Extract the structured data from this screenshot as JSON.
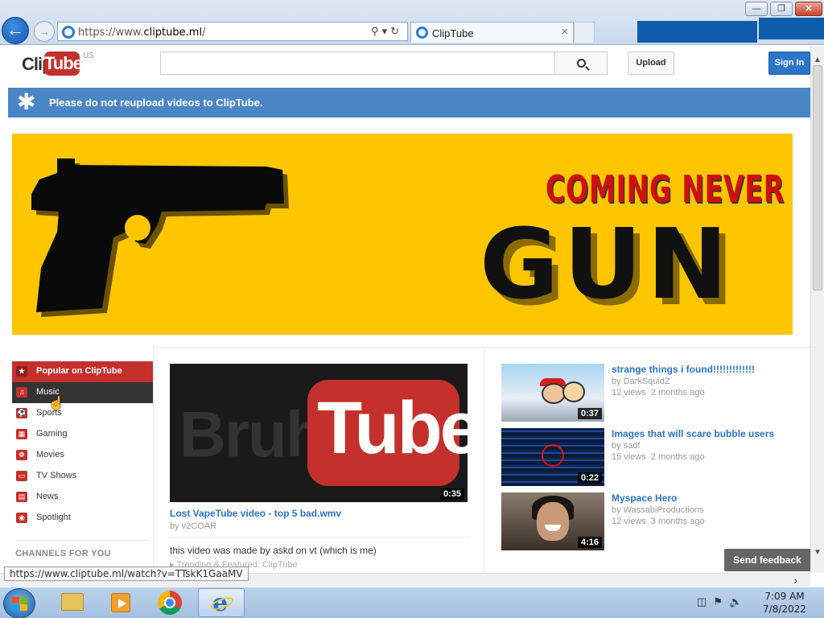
{
  "browser": {
    "url_prefix": "https://www.",
    "url_domain": "cliptube.ml",
    "url_suffix": "/",
    "tab_title": "ClipTube",
    "tab_close": "×",
    "status_url": "https://www.cliptube.ml/watch?v=TTskK1GaaMV"
  },
  "header": {
    "logo_clip": "Clip",
    "logo_tube": "Tube",
    "region": "US",
    "search_placeholder": "",
    "upload_label": "Upload",
    "signin_label": "Sign In"
  },
  "notice": {
    "text": "Please do not reupload videos to ClipTube."
  },
  "banner": {
    "line1": "COMING NEVER",
    "line2": "GUN"
  },
  "guide": {
    "items": [
      {
        "label": "Popular on ClipTube",
        "icon": "star-icon",
        "state": "active"
      },
      {
        "label": "Music",
        "icon": "headphones-icon",
        "state": "hover"
      },
      {
        "label": "Sports",
        "icon": "ball-icon",
        "state": ""
      },
      {
        "label": "Gaming",
        "icon": "gamepad-icon",
        "state": ""
      },
      {
        "label": "Movies",
        "icon": "film-reel-icon",
        "state": ""
      },
      {
        "label": "TV Shows",
        "icon": "tv-icon",
        "state": ""
      },
      {
        "label": "News",
        "icon": "newspaper-icon",
        "state": ""
      },
      {
        "label": "Spotlight",
        "icon": "spotlight-icon",
        "state": ""
      }
    ],
    "channels_heading": "CHANNELS FOR YOU"
  },
  "featured": {
    "thumb_left": "Bruh",
    "thumb_right": "Tube",
    "duration": "0:35",
    "title": "Lost VapeTube video - top 5 bad.wmv",
    "by": "by v2COAR",
    "description": "this video was made by askd on vt (which is me)",
    "category": "Trending & Featured: ClipTube"
  },
  "side_videos": [
    {
      "title": "strange things i found!!!!!!!!!!!!!",
      "by": "by DarkSquidZ",
      "views": "12 views",
      "age": "2 months ago",
      "duration": "0:37"
    },
    {
      "title": "Images that will scare bubble users",
      "by": "by sadf",
      "views": "15 views",
      "age": "2 months ago",
      "duration": "0:22"
    },
    {
      "title": "Myspace Hero",
      "by": "by WassabiProductions",
      "views": "12 views",
      "age": "3 months ago",
      "duration": "4:16"
    }
  ],
  "feedback_label": "Send feedback",
  "taskbar": {
    "time": "7:09 AM",
    "date": "7/8/2022"
  }
}
